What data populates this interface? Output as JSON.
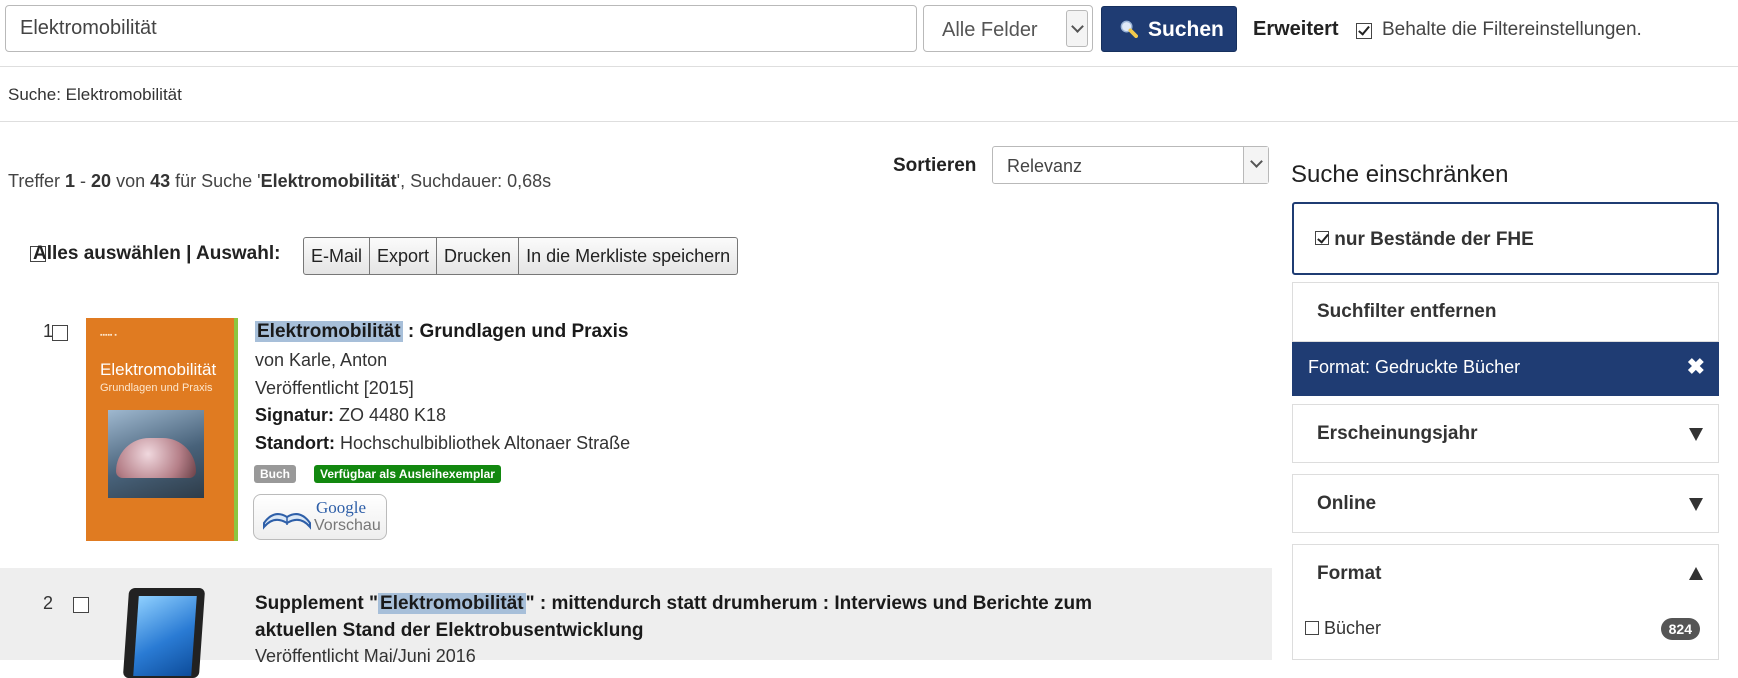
{
  "search": {
    "query": "Elektromobilität",
    "field_select": "Alle Felder",
    "button_label": "Suchen",
    "advanced_label": "Erweitert",
    "keep_filters_label": "Behalte die Filtereinstellungen.",
    "keep_filters_checked": true
  },
  "breadcrumb": "Suche: Elektromobilität",
  "results_summary": {
    "prefix": "Treffer ",
    "from": "1",
    "dash": " - ",
    "to": "20",
    "of_text": " von ",
    "total": "43",
    "for_text": " für Suche '",
    "query": "Elektromobilität",
    "time_text": "', Suchdauer: 0,68s"
  },
  "sort": {
    "label": "Sortieren",
    "value": "Relevanz"
  },
  "bulk": {
    "select_all_label": "Alles auswählen | Auswahl:",
    "buttons": [
      "E-Mail",
      "Export",
      "Drucken",
      "In die Merkliste speichern"
    ]
  },
  "results": [
    {
      "number": "1",
      "title_highlight": "Elektromobilität",
      "title_rest": " : Grundlagen und Praxis",
      "author_prefix": "von ",
      "author": "Karle, Anton",
      "published": "Veröffentlicht [2015]",
      "signature_label": "Signatur:",
      "signature": " ZO 4480 K18",
      "location_label": "Standort:",
      "location": " Hochschulbibliothek Altonaer Straße",
      "format_badge": "Buch",
      "availability_badge": "Verfügbar als Ausleihexemplar",
      "cover_title": "Elektromobilität",
      "cover_subtitle": "Grundlagen und Praxis",
      "google_preview_line1": "Google",
      "google_preview_line2": "Vorschau"
    },
    {
      "number": "2",
      "title_prefix": "Supplement \"",
      "title_highlight": "Elektromobilität",
      "title_rest": "\" : mittendurch statt drumherum : Interviews und Berichte zum",
      "title_line2": "aktuellen Stand der Elektrobusentwicklung",
      "published": "Veröffentlicht Mai/Juni 2016"
    }
  ],
  "sidebar": {
    "title": "Suche einschränken",
    "fhe_only": "nur Bestände der FHE",
    "remove_filters": "Suchfilter entfernen",
    "active_filter": "Format: Gedruckte Bücher",
    "facets": [
      "Erscheinungsjahr",
      "Online",
      "Format"
    ],
    "format_options": [
      {
        "label": "Bücher",
        "count": "824"
      }
    ]
  },
  "colors": {
    "primary": "#1f3c73",
    "highlight": "#a7bfd9",
    "available": "#12880f",
    "badge_gray": "#999999"
  }
}
